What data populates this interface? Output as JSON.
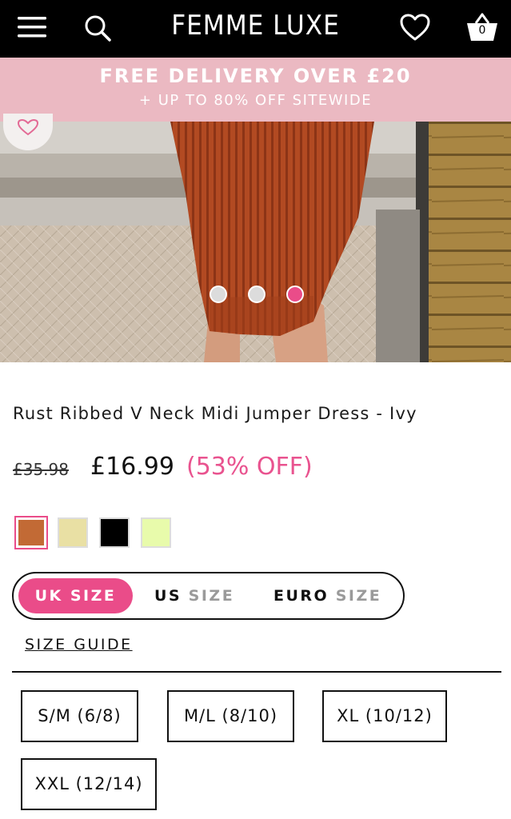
{
  "header": {
    "brand": "FEMME LUXE",
    "menu_icon": "hamburger-menu-icon",
    "search_icon": "search-icon",
    "wishlist_icon": "heart-icon",
    "basket_icon": "basket-icon",
    "basket_count": "0"
  },
  "promo": {
    "line1": "FREE DELIVERY OVER £20",
    "line2": "+ UP TO 80% OFF SITEWIDE",
    "background": "#ebb9c2"
  },
  "gallery": {
    "slide_count": 3,
    "active_slide": 3,
    "wishlist_icon": "heart-outline-icon"
  },
  "product": {
    "title": "Rust Ribbed V Neck Midi Jumper Dress - Ivy",
    "old_price": "£35.98",
    "price": "£16.99",
    "discount": "(53% OFF)",
    "swatches": [
      {
        "color": "#c26a35",
        "selected": true
      },
      {
        "color": "#e9e0a4",
        "selected": false
      },
      {
        "color": "#000000",
        "selected": false
      },
      {
        "color": "#e8fbab",
        "selected": false
      }
    ]
  },
  "size": {
    "options": [
      {
        "bold": "UK",
        "rest": "SIZE",
        "active": true
      },
      {
        "bold": "US",
        "rest": "SIZE",
        "active": false
      },
      {
        "bold": "EURO",
        "rest": "SIZE",
        "active": false
      }
    ],
    "guide_label": "SIZE GUIDE",
    "sizes": [
      "S/M (6/8)",
      "M/L (8/10)",
      "XL (10/12)",
      "XXL (12/14)"
    ]
  },
  "colors": {
    "accent": "#ea4c89",
    "discount": "#e9538f",
    "header_bg": "#000000"
  }
}
